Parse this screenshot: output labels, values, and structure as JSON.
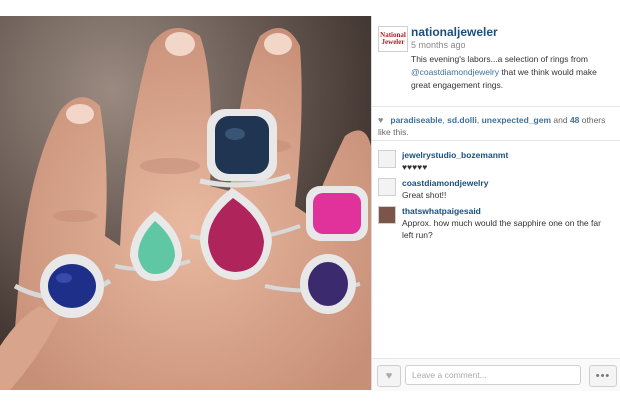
{
  "post": {
    "username": "nationaljeweler",
    "logo_text": "National Jeweler",
    "time": "5 months ago",
    "caption_before": "This evening's labors...a selection of rings from ",
    "caption_mention": "@coastdiamondjewelry",
    "caption_after": " that we think would make great engagement rings."
  },
  "likes": {
    "users": [
      "paradiseable",
      "sd.dolli",
      "unexpected_gem"
    ],
    "sep1": ", ",
    "sep2": ", ",
    "and_text": " and ",
    "others_count": "48",
    "others_text": " others like this."
  },
  "comments": [
    {
      "user": "jewelrystudio_bozemanmt",
      "text": "♥♥♥♥♥"
    },
    {
      "user": "coastdiamondjewelry",
      "text": "Great shot!!"
    },
    {
      "user": "thatswhatpaigesaid",
      "text": "Approx. how much would the sapphire one on the far left run?"
    }
  ],
  "footer": {
    "comment_placeholder": "Leave a comment...",
    "like_icon": "heart-icon",
    "more_icon": "ellipsis-icon",
    "more_text": "•••",
    "like_glyph": "♥"
  },
  "colors": {
    "username": "#1c4f7c",
    "mention": "#3f729b",
    "sapphire": "#1e2f8a",
    "emerald": "#5fc7a3",
    "rubellite": "#b0245c",
    "pink_sapphire": "#e0329a",
    "tanzanite": "#3b2a6e",
    "cushion_sapphire": "#203552"
  }
}
